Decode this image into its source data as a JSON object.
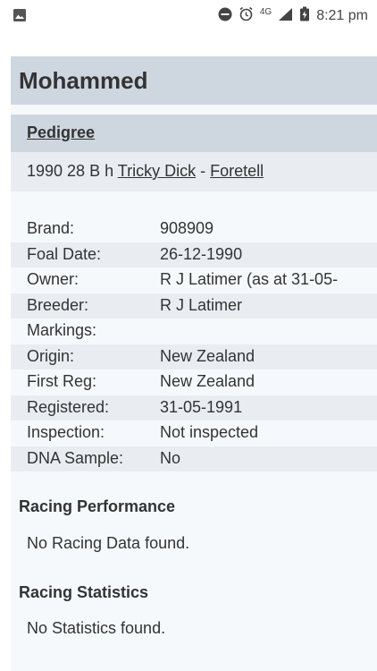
{
  "status_bar": {
    "time": "8:21 pm",
    "network": "4G",
    "icons": [
      "image-icon",
      "do-not-disturb-icon",
      "alarm-icon",
      "signal-icon",
      "battery-icon"
    ]
  },
  "horse": {
    "name": "Mohammed",
    "pedigree_label": "Pedigree",
    "summary_prefix": "1990 28 B h ",
    "sire": "Tricky Dick",
    "separator": " - ",
    "dam": "Foretell"
  },
  "details": [
    {
      "label": "Brand:",
      "value": "908909"
    },
    {
      "label": "Foal Date:",
      "value": "26-12-1990"
    },
    {
      "label": "Owner:",
      "value": "R J Latimer    (as at 31-05-"
    },
    {
      "label": "Breeder:",
      "value": "R J Latimer"
    },
    {
      "label": "Markings:",
      "value": ""
    },
    {
      "label": "Origin:",
      "value": "New Zealand"
    },
    {
      "label": "First Reg:",
      "value": "New Zealand"
    },
    {
      "label": "Registered:",
      "value": "31-05-1991"
    },
    {
      "label": "Inspection:",
      "value": "Not inspected"
    },
    {
      "label": "DNA Sample:",
      "value": "No"
    }
  ],
  "racing_performance": {
    "heading": "Racing Performance",
    "text": "No Racing Data found."
  },
  "racing_statistics": {
    "heading": "Racing Statistics",
    "text": "No Statistics found."
  },
  "colors": {
    "header_bg": "#ced7e0",
    "alt_row_bg": "#e9edf1",
    "card_bg": "#f6f9fc"
  }
}
